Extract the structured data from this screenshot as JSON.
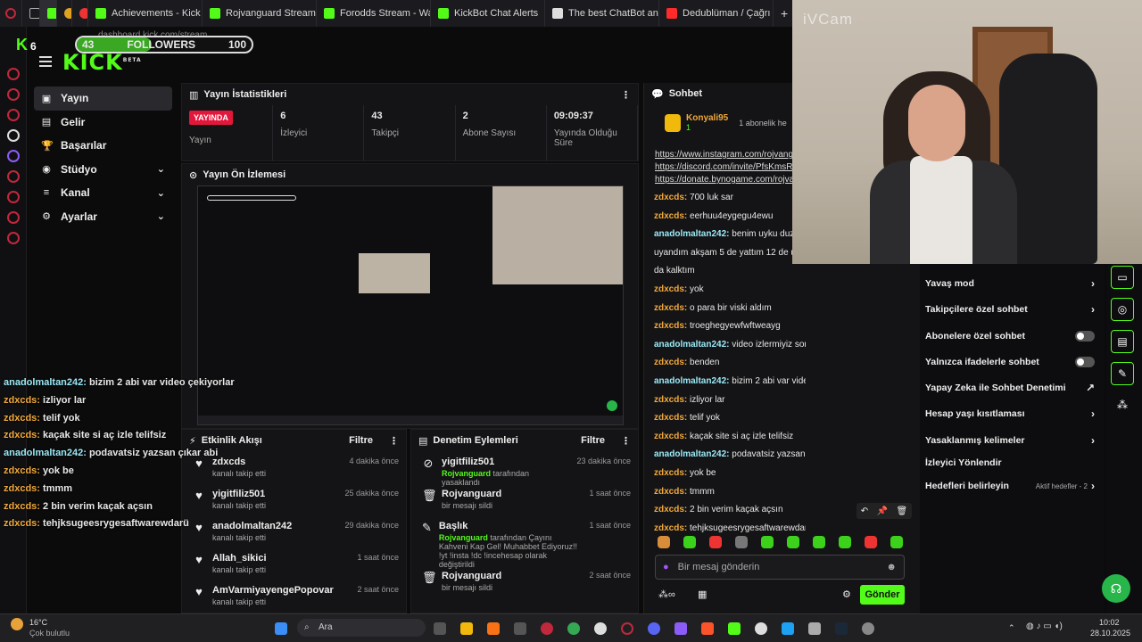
{
  "browser": {
    "tabs": [
      {
        "label": "Achievements - Kick Das",
        "color": "#53fc18"
      },
      {
        "label": "Rojvanguard Stream - W",
        "color": "#53fc18"
      },
      {
        "label": "Forodds Stream - Watch",
        "color": "#53fc18"
      },
      {
        "label": "KickBot Chat Alerts",
        "color": "#53fc18"
      },
      {
        "label": "The best ChatBot and W",
        "color": "#dddddd"
      },
      {
        "label": "Dedublüman / Çağrı Çelik",
        "color": "#ff2a2a"
      }
    ],
    "new_tab": "+",
    "address": "dashboard.kick.com/stream"
  },
  "overlay": {
    "followers_current": "43",
    "followers_label": "FOLLOWERS",
    "followers_goal": "100",
    "followers_progress": 0.43,
    "k_count": "6",
    "logo": "KICK",
    "logo_beta": "BETA",
    "chat": [
      {
        "user": "anadolmaltan242:",
        "text": " bizim 2 abi var video çekiyorlar",
        "type": "cyan"
      },
      {
        "user": "zdxcds:",
        "text": " izliyor lar",
        "type": "orange"
      },
      {
        "user": "zdxcds:",
        "text": " telif yok",
        "type": "orange"
      },
      {
        "user": "zdxcds:",
        "text": " kaçak site si aç izle telifsiz",
        "type": "orange"
      },
      {
        "user": "anadolmaltan242:",
        "text": " podavatsiz yazsan çıkar abi",
        "type": "cyan"
      },
      {
        "user": "zdxcds:",
        "text": " yok be",
        "type": "orange"
      },
      {
        "user": "zdxcds:",
        "text": " tmmm",
        "type": "orange"
      },
      {
        "user": "zdxcds:",
        "text": " 2 bin verim kaçak açsın",
        "type": "orange"
      },
      {
        "user": "zdxcds:",
        "text": " tehjksugeesrygesaftwarewdarü",
        "type": "orange"
      }
    ]
  },
  "nav": [
    {
      "label": "Yayın",
      "icon": "broadcast-icon",
      "glyph": "▣",
      "active": true,
      "expand": false
    },
    {
      "label": "Gelir",
      "icon": "revenue-icon",
      "glyph": "▤",
      "active": false,
      "expand": false
    },
    {
      "label": "Başarılar",
      "icon": "trophy-icon",
      "glyph": "🏆",
      "active": false,
      "expand": false
    },
    {
      "label": "Stüdyo",
      "icon": "studio-icon",
      "glyph": "◉",
      "active": false,
      "expand": true
    },
    {
      "label": "Kanal",
      "icon": "channel-icon",
      "glyph": "≡",
      "active": false,
      "expand": true
    },
    {
      "label": "Ayarlar",
      "icon": "gear-icon",
      "glyph": "⚙",
      "active": false,
      "expand": true
    }
  ],
  "stats": {
    "title": "Yayın İstatistikleri",
    "live_badge": "YAYINDA",
    "live_label": "Yayın",
    "items": [
      {
        "value": "6",
        "label": "İzleyici"
      },
      {
        "value": "43",
        "label": "Takipçi"
      },
      {
        "value": "2",
        "label": "Abone Sayısı"
      },
      {
        "value": "09:09:37",
        "label": "Yayında Olduğu Süre"
      }
    ]
  },
  "preview": {
    "title": "Yayın Ön İzlemesi"
  },
  "activity": {
    "title": "Etkinlik Akışı",
    "filter": "Filtre",
    "items": [
      {
        "name": "zdxcds",
        "sub": "kanalı takip etti",
        "time": "4 dakika önce"
      },
      {
        "name": "yigitfiliz501",
        "sub": "kanalı takip etti",
        "time": "25 dakika önce"
      },
      {
        "name": "anadolmaltan242",
        "sub": "kanalı takip etti",
        "time": "29 dakika önce"
      },
      {
        "name": "Allah_sikici",
        "sub": "kanalı takip etti",
        "time": "1 saat önce"
      },
      {
        "name": "AmVarmiyayengePopovar",
        "sub": "kanalı takip etti",
        "time": "2 saat önce"
      }
    ]
  },
  "moderation": {
    "title": "Denetim Eylemleri",
    "filter": "Filtre",
    "items": [
      {
        "name": "yigitfiliz501",
        "by": "Rojvanguard",
        "sub": " tarafından yasaklandı",
        "time": "23 dakika önce",
        "glyph": "⊘"
      },
      {
        "name": "Rojvanguard",
        "by": "",
        "sub": "bir mesajı sildi",
        "time": "1 saat önce",
        "glyph": "🗑"
      },
      {
        "name": "Başlık",
        "by": "Rojvanguard",
        "sub": " tarafından Çayını Kahveni Kap Gel! Muhabbet Ediyoruz!! !yt !insta !dc !incehesap olarak değiştirildi",
        "time": "1 saat önce",
        "glyph": "✎"
      },
      {
        "name": "Rojvanguard",
        "by": "",
        "sub": "bir mesajı sildi",
        "time": "2 saat önce",
        "glyph": "🗑"
      }
    ]
  },
  "chat": {
    "title": "Sohbet",
    "pinned_user": "Konyali95",
    "pinned_count": "1",
    "pinned_sub": "1 abonelik he",
    "links": [
      "https://www.instagram.com/rojvangu",
      "https://discord.com/invite/PfsKmsRM",
      "https://donate.bynogame.com/rojvang"
    ],
    "messages": [
      {
        "user": "zdxcds:",
        "text": " 700 luk sar",
        "type": "orange"
      },
      {
        "user": "zdxcds:",
        "text": " eerhuu4eygegu4ewu",
        "type": "orange"
      },
      {
        "user": "anadolmaltan242:",
        "text": " benim uyku duzen",
        "type": "cyan"
      },
      {
        "user": "",
        "text": "uyandım akşam 5 de yattım 12 de uya",
        "type": "plain"
      },
      {
        "user": "",
        "text": "da kalktım",
        "type": "plain"
      },
      {
        "user": "zdxcds:",
        "text": " yok",
        "type": "orange"
      },
      {
        "user": "zdxcds:",
        "text": " o para bir viski aldım",
        "type": "orange"
      },
      {
        "user": "zdxcds:",
        "text": " troeghegyewfwftweayg",
        "type": "orange"
      },
      {
        "user": "anadolmaltan242:",
        "text": " video izlermiyiz sonra abi",
        "type": "cyan"
      },
      {
        "user": "zdxcds:",
        "text": " benden",
        "type": "orange"
      },
      {
        "user": "anadolmaltan242:",
        "text": " bizim 2 abi var video çekiyorlar",
        "type": "cyan"
      },
      {
        "user": "zdxcds:",
        "text": " izliyor lar",
        "type": "orange"
      },
      {
        "user": "zdxcds:",
        "text": " telif yok",
        "type": "orange"
      },
      {
        "user": "zdxcds:",
        "text": " kaçak site si aç izle telifsiz",
        "type": "orange"
      },
      {
        "user": "anadolmaltan242:",
        "text": " podavatsiz yazsan çıkar abi",
        "type": "cyan"
      },
      {
        "user": "zdxcds:",
        "text": " yok be",
        "type": "orange"
      },
      {
        "user": "zdxcds:",
        "text": " tmmm",
        "type": "orange"
      },
      {
        "user": "zdxcds:",
        "text": " 2 bin verim kaçak açsın",
        "type": "orange"
      },
      {
        "user": "zdxcds:",
        "text": " tehjksugeesrygesaftwarewdarü",
        "type": "orange"
      }
    ],
    "input_placeholder": "Bir mesaj gönderin",
    "send_label": "Gönder"
  },
  "webcam": {
    "watermark": "iVCam"
  },
  "settings": [
    {
      "label": "Yavaş mod",
      "control": "chevron"
    },
    {
      "label": "Takipçilere özel sohbet",
      "control": "chevron"
    },
    {
      "label": "Abonelere özel sohbet",
      "control": "toggle"
    },
    {
      "label": "Yalnızca ifadelerle sohbet",
      "control": "toggle"
    },
    {
      "label": "Yapay Zeka ile Sohbet Denetimi",
      "control": "external"
    },
    {
      "label": "Hesap yaşı kısıtlaması",
      "control": "chevron"
    },
    {
      "label": "Yasaklanmış kelimeler",
      "control": "chevron"
    },
    {
      "label": "İzleyici Yönlendir",
      "control": "none"
    },
    {
      "label": "Hedefleri belirleyin",
      "control": "chevron",
      "extra": "Aktif hedefler - 2"
    }
  ],
  "taskbar": {
    "weather_temp": "16°C",
    "weather_desc": "Çok bulutlu",
    "search_placeholder": "Ara",
    "time": "10:02",
    "date": "28.10.2025"
  },
  "colors": {
    "brand": "#53fc18",
    "live": "#e3173c",
    "cyan_user": "#9be9f5",
    "orange_user": "#f2a93a"
  }
}
